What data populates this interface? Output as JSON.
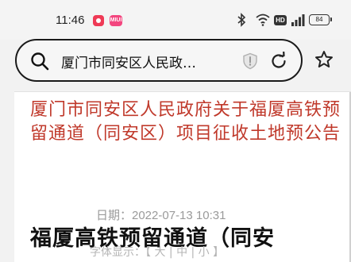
{
  "status_bar": {
    "time": "11:46",
    "app_badge": "MIUI",
    "network": "HD",
    "battery": "84"
  },
  "address_bar": {
    "url_text": "厦门市同安区人民政…"
  },
  "article": {
    "title": "厦门市同安区人民政府关于福厦高铁预留通道（同安区）项目征收土地预公告",
    "date": "日期：2022-07-13 10:31",
    "headline": "福厦高铁预留通道（同安",
    "font_size_label": "字体显示：【 大 | 中 | 小 】"
  },
  "colors": {
    "title_red": "#c0392b",
    "date_grey": "#9a9a9a"
  },
  "icons": [
    "search-icon",
    "shield-icon",
    "reload-icon",
    "star-icon",
    "bluetooth-icon",
    "wifi-icon",
    "signal-icon",
    "battery-icon"
  ]
}
